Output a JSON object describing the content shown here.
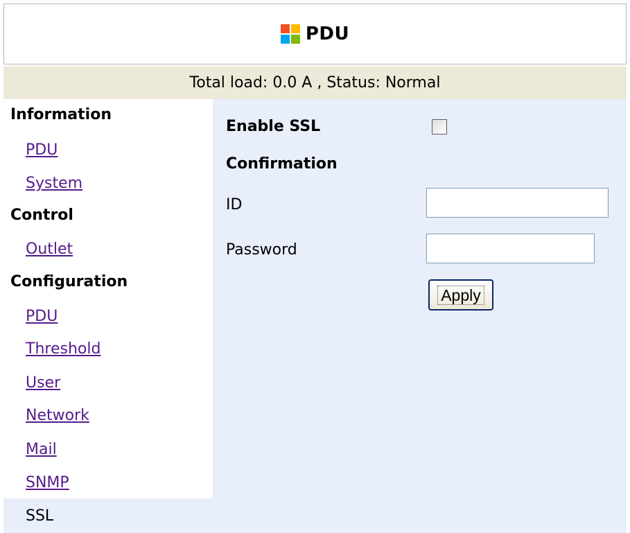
{
  "header": {
    "title": "PDU",
    "icon": "windows-logo-icon",
    "icon_colors": [
      "#f25022",
      "#7fba00",
      "#00a4ef",
      "#ffb900"
    ]
  },
  "status": {
    "text": "Total load: 0.0 A , Status: Normal"
  },
  "sidebar": {
    "sections": [
      {
        "title": "Information",
        "items": [
          "PDU",
          "System"
        ]
      },
      {
        "title": "Control",
        "items": [
          "Outlet"
        ]
      },
      {
        "title": "Configuration",
        "items": [
          "PDU",
          "Threshold",
          "User",
          "Network",
          "Mail",
          "SNMP",
          "SSL"
        ]
      }
    ],
    "active_item": "SSL",
    "link_color": "#551a8b"
  },
  "form": {
    "enable_ssl_label": "Enable SSL",
    "enable_ssl_checked": false,
    "confirmation_label": "Confirmation",
    "id_label": "ID",
    "id_value": "",
    "password_label": "Password",
    "password_value": "",
    "apply_label": "Apply"
  },
  "colors": {
    "status_bg": "#ece9d8",
    "content_bg": "#e8eefa"
  }
}
